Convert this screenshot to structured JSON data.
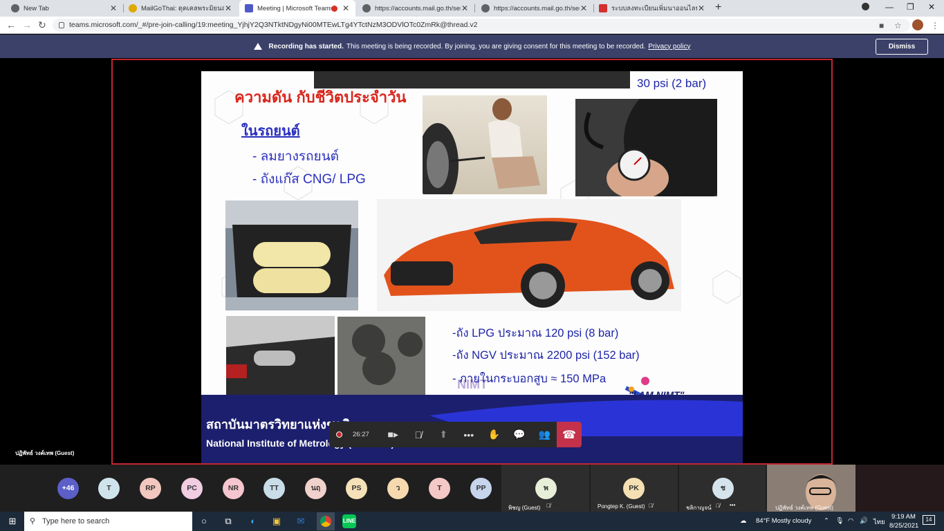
{
  "browser": {
    "tabs": [
      {
        "title": "New Tab",
        "favicon": "chrome-icon",
        "color": "#5f6368"
      },
      {
        "title": "MailGoThai: ดุคเคลพระมิยนสำหรับ ม",
        "favicon": "mail-icon",
        "color": "#e0a800"
      },
      {
        "title": "Meeting | Microsoft Teams",
        "favicon": "teams-icon",
        "color": "#5059c9"
      },
      {
        "title": "https://accounts.mail.go.th/servic",
        "favicon": "globe-icon",
        "color": "#5f6368"
      },
      {
        "title": "https://accounts.mail.go.th/servic",
        "favicon": "globe-icon",
        "color": "#5f6368"
      },
      {
        "title": "ระบบลงทะเบียนเพิ่มนาออนไลน์ :",
        "favicon": "gem-icon",
        "color": "#d32f2f"
      }
    ],
    "url": "teams.microsoft.com/_#/pre-join-calling/19:meeting_YjhjY2Q3NTktNDgyNi00MTEwLTg4YTctNzM3ODVlOTc0ZmRk@thread.v2"
  },
  "banner": {
    "strong": "Recording has started.",
    "text": "This meeting is being recorded. By joining, you are giving consent for this meeting to be recorded.",
    "link": "Privacy policy",
    "dismiss": "Dismiss"
  },
  "slide": {
    "title": "ความดัน กับชีวิตประจำวัน",
    "top_right": "30 psi (2 bar)",
    "subtitle": "ในรถยนต์",
    "bullet1": "- ลมยางรถยนต์",
    "bullet2": "- ถังแก๊ส CNG/ LPG",
    "line1": "-ถัง LPG  ประมาณ  120 psi (8 bar)",
    "line2": "-ถัง NGV  ประมาณ  2200 psi (152 bar)",
    "line3": "- ภายในกระบอกสูบ  ≈  150 MPa",
    "watermark": "NIMT",
    "logo": "\"I AM NIMT\"",
    "footer_th": "สถาบันมาตรวิทยาแห่งชาติ",
    "footer_en": "National Institute of Metrology (Thailand)"
  },
  "presenter": "ปฏิพัทธ์ วงค์เทพ (Guest)",
  "call": {
    "timer": "26:27"
  },
  "participants": {
    "overflow": "+46",
    "avatars": [
      {
        "initials": "T",
        "color": "#cfe3ec"
      },
      {
        "initials": "RP",
        "color": "#f2c7c0"
      },
      {
        "initials": "PC",
        "color": "#f0cde0"
      },
      {
        "initials": "NR",
        "color": "#f5c6cf"
      },
      {
        "initials": "TT",
        "color": "#c9dde8"
      },
      {
        "initials": "นฤ",
        "color": "#f1d1cb"
      },
      {
        "initials": "PS",
        "color": "#f5e1b8"
      },
      {
        "initials": "ว",
        "color": "#f6d9ae"
      },
      {
        "initials": "T",
        "color": "#f3c8c6"
      },
      {
        "initials": "PP",
        "color": "#c6d4ec"
      }
    ],
    "tiles": [
      {
        "initials": "พ",
        "name": "พิชญ (Guest)",
        "color": "#e7efd9"
      },
      {
        "initials": "PK",
        "name": "Pongtep K. (Guest)",
        "color": "#f5e0b3"
      },
      {
        "initials": "ช",
        "name": "ชลิกาญจน์",
        "color": "#d5e4ec"
      }
    ],
    "camera_name": "ปฏิพัทธ์ วงค์เทพ (Guest)"
  },
  "taskbar": {
    "search_placeholder": "Type here to search",
    "weather": "84°F  Mostly cloudy",
    "lang": "ไทย",
    "time": "9:19 AM",
    "date": "8/25/2021",
    "notifications": "14"
  }
}
